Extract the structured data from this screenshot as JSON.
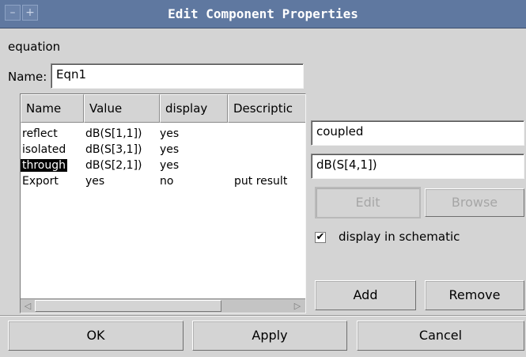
{
  "window": {
    "title": "Edit Component Properties",
    "titlebar_color": "#5f78a0"
  },
  "component_type": "equation",
  "name_label": "Name:",
  "name_value": "Eqn1",
  "table": {
    "headers": [
      "Name",
      "Value",
      "display",
      "Descriptic"
    ],
    "rows": [
      {
        "name": "reflect",
        "value": "dB(S[1,1])",
        "display": "yes",
        "description": ""
      },
      {
        "name": "isolated",
        "value": "dB(S[3,1])",
        "display": "yes",
        "description": ""
      },
      {
        "name": "through",
        "value": "dB(S[2,1])",
        "display": "yes",
        "description": "",
        "selected": true
      },
      {
        "name": "Export",
        "value": "yes",
        "display": "no",
        "description": "put result"
      }
    ]
  },
  "property_name_value": "coupled",
  "property_value_value": "dB(S[4,1])",
  "buttons": {
    "edit": "Edit",
    "browse": "Browse",
    "add": "Add",
    "remove": "Remove",
    "ok": "OK",
    "apply": "Apply",
    "cancel": "Cancel"
  },
  "display_in_schematic": {
    "label": "display in schematic",
    "checked": true,
    "mark": "✔"
  },
  "icons": [
    "window-menu-icon",
    "sticky-icon",
    "scroll-left-icon",
    "scroll-right-icon",
    "checkmark-icon"
  ]
}
